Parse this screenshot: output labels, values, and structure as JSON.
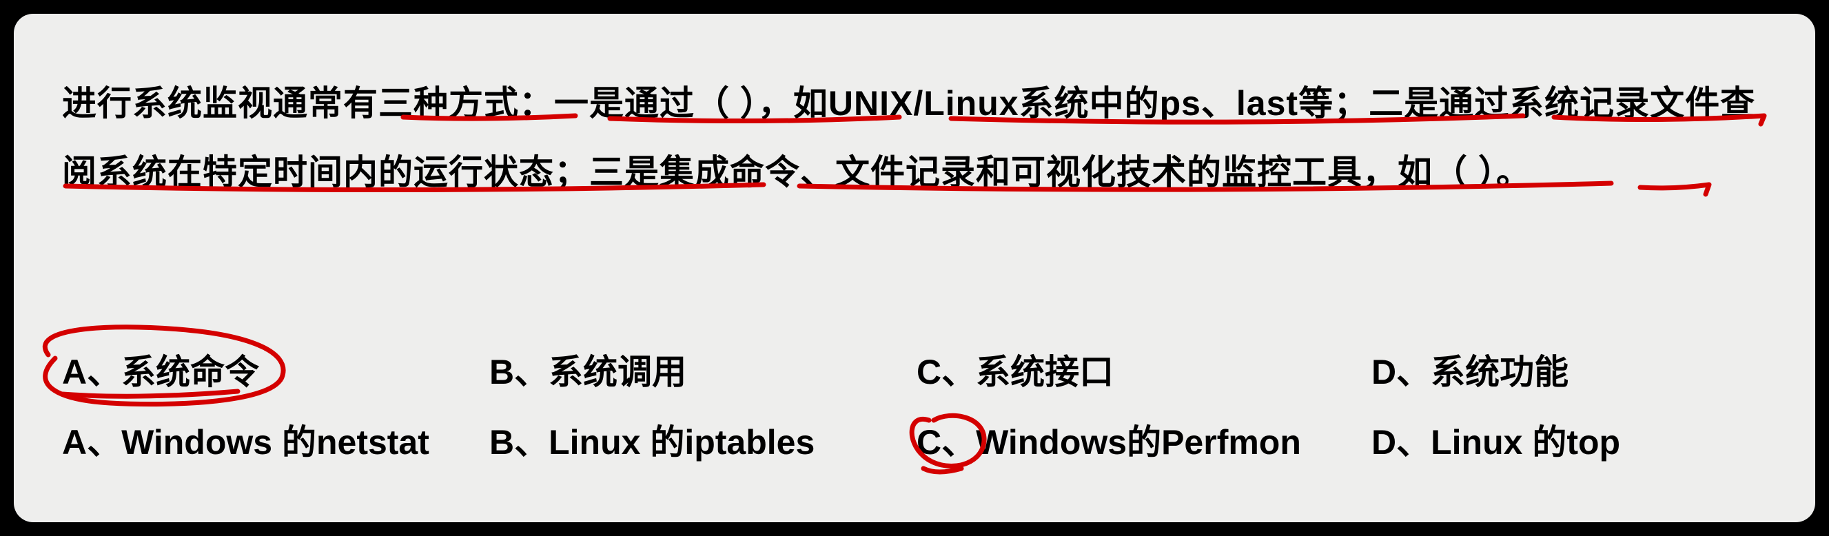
{
  "question": {
    "stem": "进行系统监视通常有三种方式：一是通过（ ），如UNIX/Linux系统中的ps、last等；二是通过系统记录文件查阅系统在特定时间内的运行状态；三是集成命令、文件记录和可视化技术的监控工具，如（ ）。"
  },
  "options_row1": {
    "a": "A、系统命令",
    "b": "B、系统调用",
    "c": "C、系统接口",
    "d": "D、系统功能"
  },
  "options_row2": {
    "a": "A、Windows 的netstat",
    "b": "B、Linux 的iptables",
    "c": "C、Windows的Perfmon",
    "d": "D、Linux 的top"
  },
  "annotations": {
    "underline_color": "#d40000",
    "circled_row1": "A",
    "circled_row2": "C"
  }
}
